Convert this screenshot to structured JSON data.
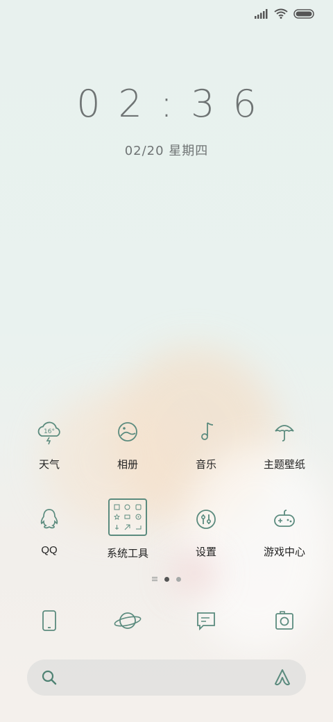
{
  "status_bar": {
    "signal_icon": "signal-icon",
    "wifi_icon": "wifi-icon",
    "battery_icon": "battery-icon"
  },
  "lockscreen": {
    "time": "02:36",
    "date": "02/20 星期四"
  },
  "apps": [
    {
      "label": "天气",
      "icon": "weather-icon",
      "badge": "16°"
    },
    {
      "label": "相册",
      "icon": "gallery-icon"
    },
    {
      "label": "音乐",
      "icon": "music-icon"
    },
    {
      "label": "主题壁纸",
      "icon": "theme-icon"
    },
    {
      "label": "QQ",
      "icon": "qq-icon"
    },
    {
      "label": "系统工具",
      "icon": "folder-icon"
    },
    {
      "label": "设置",
      "icon": "settings-icon"
    },
    {
      "label": "游戏中心",
      "icon": "game-center-icon"
    }
  ],
  "dock": [
    {
      "icon": "phone-icon"
    },
    {
      "icon": "browser-icon"
    },
    {
      "icon": "messages-icon"
    },
    {
      "icon": "camera-icon"
    }
  ],
  "search": {
    "search_icon": "search-icon",
    "assistant_icon": "assistant-icon"
  },
  "page_indicator": {
    "pages": 2,
    "current": 1
  },
  "colors": {
    "icon_stroke": "#5b8b7e",
    "label": "#222222",
    "clock": "#6e7373"
  }
}
